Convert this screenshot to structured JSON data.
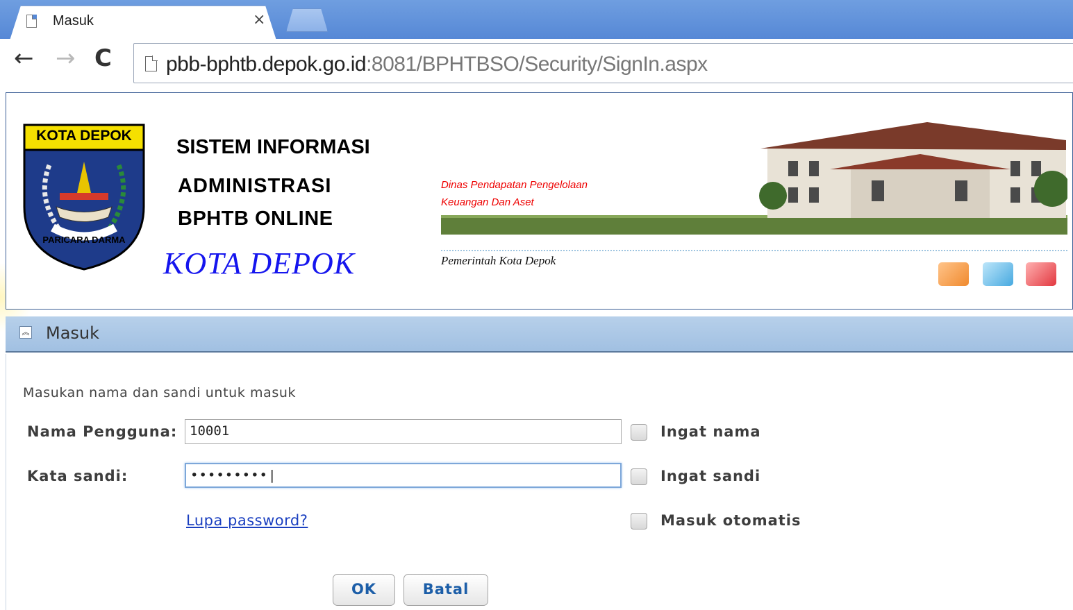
{
  "browser": {
    "tab_title": "Masuk",
    "tab_close": "×",
    "url_host": "pbb-bphtb.depok.go.id",
    "url_rest": ":8081/BPHTBSO/Security/SignIn.aspx",
    "nav": {
      "back": "←",
      "forward": "→",
      "reload": "C"
    }
  },
  "banner": {
    "emblem_label": "KOTA DEPOK",
    "emblem_motto": "PARICARA DARMA",
    "system_line1": "SISTEM INFORMASI",
    "system_line2": "ADMINISTRASI",
    "system_line3": "BPHTB ONLINE",
    "city": "KOTA DEPOK",
    "dinas_line1": "Dinas Pendapatan Pengelolaan",
    "dinas_line2": "Keuangan Dan Aset",
    "pemkot": "Pemerintah Kota Depok"
  },
  "login": {
    "title": "Masuk",
    "intro": "Masukan nama dan sandi untuk masuk",
    "username_label": "Nama Pengguna:",
    "username_value": "10001",
    "password_label": "Kata sandi:",
    "password_value": "•••••••••|",
    "remember_name": "Ingat nama",
    "remember_password": "Ingat sandi",
    "auto_login": "Masuk otomatis",
    "forgot": "Lupa password?",
    "ok": "OK",
    "cancel": "Batal"
  },
  "colors": {
    "tabstrip": "#5688d6",
    "panel_header": "#a1c0e2",
    "city_text": "#1515ee",
    "dinas_text": "#ee0000",
    "button_text": "#1c5ea8"
  }
}
